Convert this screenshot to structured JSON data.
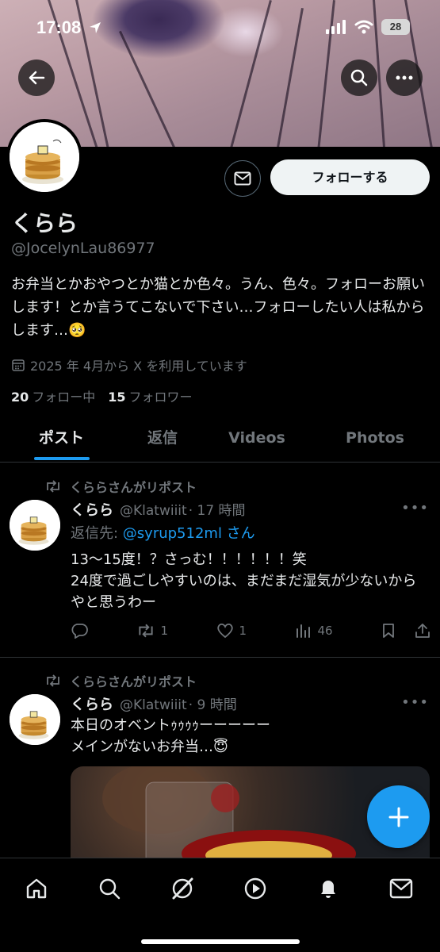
{
  "status_bar": {
    "time": "17:08",
    "battery": "28"
  },
  "profile": {
    "name": "くらら",
    "handle": "@JocelynLau86977",
    "bio": "お弁当とかおやつとか猫とか色々。うん、色々。フォローお願いします！とか言うてこないで下さい…フォローしたい人は私からします…🥺",
    "joined": "2025 年 4月から X を利用しています",
    "following_count": "20",
    "following_label": "フォロー中",
    "followers_count": "15",
    "followers_label": "フォロワー",
    "follow_button": "フォローする"
  },
  "tabs": [
    {
      "label": "ポスト",
      "active": true
    },
    {
      "label": "返信",
      "active": false
    },
    {
      "label": "Videos",
      "active": false
    },
    {
      "label": "Photos",
      "active": false
    }
  ],
  "posts": [
    {
      "repost_label": "くららさんがリポスト",
      "author": "くらら",
      "handle": "@Klatwiiit",
      "time": "· 17 時間",
      "reply_prefix": "返信先: ",
      "reply_to": "@syrup512ml さん",
      "text": "13〜15度！？さっむ！！！！！！笑\n24度で過ごしやすいのは、まだまだ湿気が少ないからやと思うわー",
      "retweets": "1",
      "likes": "1",
      "views": "46"
    },
    {
      "repost_label": "くららさんがリポスト",
      "author": "くらら",
      "handle": "@Klatwiiit",
      "time": "· 9 時間",
      "text": "本日のオベントｩｩｩｩーーーーー\nメインがないお弁当…😇"
    }
  ],
  "colors": {
    "accent": "#1d9bf0",
    "background": "#000000",
    "secondary_text": "#71767b"
  }
}
